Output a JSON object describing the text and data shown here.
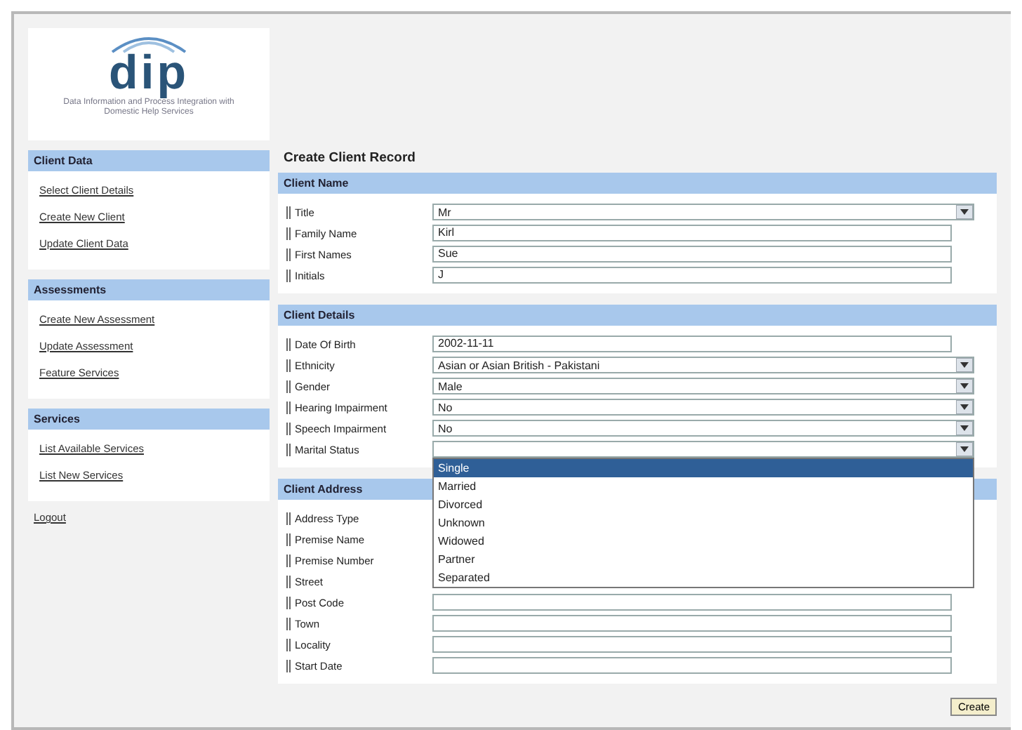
{
  "logo": {
    "text": "dip",
    "tagline": "Data Information and Process Integration with Domestic Help Services"
  },
  "sidebar": [
    {
      "title": "Client Data",
      "items": [
        "Select Client Details",
        "Create New Client",
        "Update Client Data"
      ]
    },
    {
      "title": "Assessments",
      "items": [
        "Create New Assessment",
        "Update Assessment",
        "Feature Services"
      ]
    },
    {
      "title": "Services",
      "items": [
        "List Available Services",
        "List New Services"
      ]
    }
  ],
  "logout": "Logout",
  "page_title": "Create Client Record",
  "sections": [
    {
      "title": "Client Name",
      "rows": [
        {
          "label": "Title",
          "kind": "select",
          "value": "Mr"
        },
        {
          "label": "Family Name",
          "kind": "text",
          "value": "Kirl"
        },
        {
          "label": "First Names",
          "kind": "text",
          "value": "Sue"
        },
        {
          "label": "Initials",
          "kind": "text",
          "value": "J"
        }
      ]
    },
    {
      "title": "Client Details",
      "rows": [
        {
          "label": "Date Of Birth",
          "kind": "text",
          "value": "2002-11-11"
        },
        {
          "label": "Ethnicity",
          "kind": "select",
          "value": "Asian or Asian British - Pakistani"
        },
        {
          "label": "Gender",
          "kind": "select",
          "value": "Male"
        },
        {
          "label": "Hearing Impairment",
          "kind": "select",
          "value": "No"
        },
        {
          "label": "Speech Impairment",
          "kind": "select",
          "value": "No"
        },
        {
          "label": "Marital Status",
          "kind": "select",
          "value": "",
          "expanded": true,
          "options": [
            {
              "label": "Single",
              "selected": true
            },
            {
              "label": "Married",
              "selected": false
            },
            {
              "label": "Divorced",
              "selected": false
            },
            {
              "label": "Unknown",
              "selected": false
            },
            {
              "label": "Widowed",
              "selected": false
            },
            {
              "label": "Partner",
              "selected": false
            },
            {
              "label": "Separated",
              "selected": false
            }
          ]
        }
      ]
    },
    {
      "title": "Client Address",
      "rows": [
        {
          "label": "Address Type",
          "kind": "label"
        },
        {
          "label": "Premise Name",
          "kind": "label"
        },
        {
          "label": "Premise Number",
          "kind": "label"
        },
        {
          "label": "Street",
          "kind": "label"
        },
        {
          "label": "Post Code",
          "kind": "text",
          "value": ""
        },
        {
          "label": "Town",
          "kind": "text",
          "value": ""
        },
        {
          "label": "Locality",
          "kind": "text",
          "value": ""
        },
        {
          "label": "Start Date",
          "kind": "text",
          "value": ""
        }
      ]
    }
  ],
  "create_button": "Create"
}
